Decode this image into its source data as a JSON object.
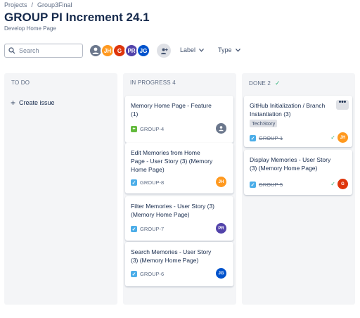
{
  "breadcrumb": {
    "projects": "Projects",
    "sep": "/",
    "project": "Group3Final"
  },
  "header": {
    "title": "GROUP PI Increment 24.1",
    "subtitle": "Develop Home Page"
  },
  "search": {
    "placeholder": "Search"
  },
  "avatars": [
    {
      "initials": "",
      "color": "#6b778c"
    },
    {
      "initials": "JH",
      "color": "#ff991f"
    },
    {
      "initials": "G",
      "color": "#de350b"
    },
    {
      "initials": "PR",
      "color": "#5243aa"
    },
    {
      "initials": "JG",
      "color": "#0052cc"
    }
  ],
  "filters": {
    "label": "Label",
    "type": "Type"
  },
  "columns": {
    "todo": {
      "title": "TO DO",
      "create": "Create issue"
    },
    "inprogress": {
      "title": "IN PROGRESS 4"
    },
    "done": {
      "title": "DONE 2",
      "check": "✓"
    }
  },
  "cards": {
    "c4": {
      "summary": "Memory Home Page - Feature (1)",
      "key": "GROUP-4",
      "assignee": ""
    },
    "c8": {
      "summary": "Edit Memories from Home Page - User Story (3) (Memory Home Page)",
      "key": "GROUP-8",
      "assignee": "JH"
    },
    "c7": {
      "summary": "Filter Memories - User Story (3) (Memory Home Page)",
      "key": "GROUP-7",
      "assignee": "PR"
    },
    "c6": {
      "summary": "Search Memories - User Story (3) (Memory Home Page)",
      "key": "GROUP-6",
      "assignee": "JG"
    },
    "c1": {
      "summary": "GitHub Initialization / Branch Instantiation (3)",
      "label": "TechStory",
      "key": "GROUP-1",
      "assignee": "JH",
      "more": "•••"
    },
    "c5": {
      "summary": "Display Memories - User Story (3) (Memory Home Page)",
      "key": "GROUP-5",
      "assignee": "G"
    }
  },
  "colors": {
    "accent": "#0052cc",
    "done_green": "#36b37e",
    "column_bg": "#f4f5f7"
  }
}
